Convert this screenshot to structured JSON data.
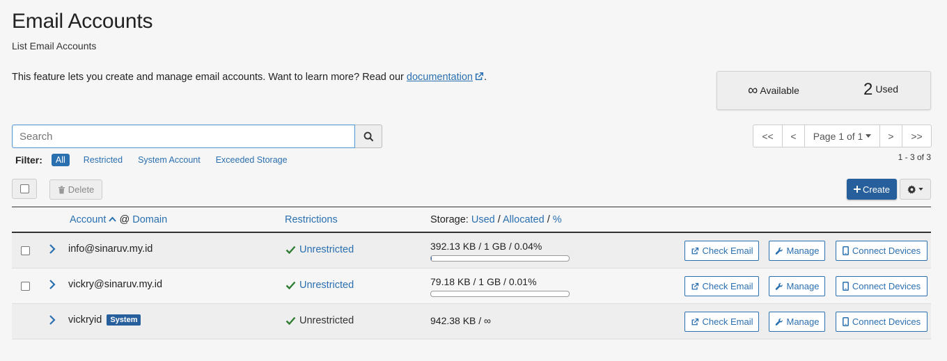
{
  "header": {
    "title": "Email Accounts",
    "subtitle": "List Email Accounts",
    "intro_text": "This feature lets you create and manage email accounts. Want to learn more? Read our ",
    "doc_link": "documentation",
    "intro_end": "."
  },
  "stats": {
    "available_symbol": "∞",
    "available_label": "Available",
    "used_count": "2",
    "used_label": "Used"
  },
  "search": {
    "placeholder": "Search"
  },
  "pagination": {
    "first": "<<",
    "prev": "<",
    "page_label": "Page 1 of 1",
    "next": ">",
    "last": ">>",
    "range": "1 - 3 of 3"
  },
  "filter": {
    "label": "Filter:",
    "options": [
      "All",
      "Restricted",
      "System Account",
      "Exceeded Storage"
    ],
    "active": "All"
  },
  "toolbar": {
    "delete_label": "Delete",
    "create_label": "Create"
  },
  "table": {
    "col_account": "Account",
    "col_at": "@",
    "col_domain": "Domain",
    "col_restrictions": "Restrictions",
    "col_storage_prefix": "Storage:",
    "col_used": "Used",
    "col_allocated": "Allocated",
    "col_percent": "%",
    "sep": "/",
    "rows": [
      {
        "account": "info@sinaruv.my.id",
        "restriction": "Unrestricted",
        "storage": "392.13 KB / 1 GB / 0.04%",
        "usage_fraction": 0.0004
      },
      {
        "account": "vickry@sinaruv.my.id",
        "restriction": "Unrestricted",
        "storage": "79.18 KB / 1 GB / 0.01%",
        "usage_fraction": 0.0001
      },
      {
        "account": "vickryid",
        "badge": "System",
        "restriction": "Unrestricted",
        "storage": "942.38 KB / ∞"
      }
    ],
    "actions": {
      "check_email": "Check Email",
      "manage": "Manage",
      "connect_devices": "Connect Devices"
    }
  },
  "colors": {
    "link": "#2a6fb0",
    "primary_button": "#275f9c",
    "check_green": "#2e7d32"
  }
}
